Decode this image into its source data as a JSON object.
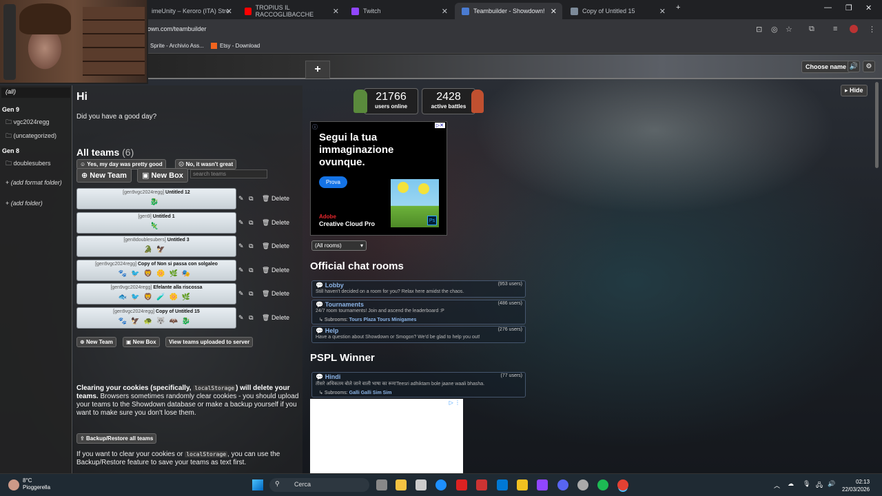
{
  "browser": {
    "tabs": [
      {
        "label": "imeUnity – Keroro (ITA) Stre",
        "color": "#3b5998"
      },
      {
        "label": "TROPIUS IL RACCOGLIBACCHE",
        "color": "#ff0000"
      },
      {
        "label": "Twitch",
        "color": "#9146ff"
      },
      {
        "label": "Teambuilder - Showdown!",
        "color": "#4a7bd1"
      },
      {
        "label": "Copy of Untitled 15",
        "color": "#7c8a99"
      }
    ],
    "url": "own.com/teambuilder",
    "bookmarks": [
      "Sprite - Archivio Ass...",
      "Etsy - Download"
    ]
  },
  "header": {
    "choose_name": "Choose name",
    "new_tab": "+"
  },
  "sidebar": {
    "all": "(all)",
    "gen9": "Gen 9",
    "gen9_folders": [
      "vgc2024regg",
      "(uncategorized)"
    ],
    "gen8": "Gen 8",
    "gen8_folders": [
      "doublesubers"
    ],
    "add_format_folder": "(add format folder)",
    "add_folder": "(add folder)"
  },
  "teams_panel": {
    "greeting": "Hi",
    "question": "Did you have a good day?",
    "yes": "Yes, my day was pretty good",
    "no": "No, it wasn't great",
    "all_teams": "All teams",
    "count": "(6)",
    "new_team": "New Team",
    "new_box": "New Box",
    "search_placeholder": "search teams",
    "teams": [
      {
        "format": "[gen9vgc2024regg]",
        "name": "Untitled 12",
        "mons": "🐉"
      },
      {
        "format": "[gen9]",
        "name": "Untitled 1",
        "mons": "🦎"
      },
      {
        "format": "[gen8doublesubers]",
        "name": "Untitled 3",
        "mons": "🐊🦅"
      },
      {
        "format": "[gen9vgc2024regg]",
        "name": "Copy of Non si passa con solgaleo",
        "mons": "🐾🐦🦁🌼🌿🎭"
      },
      {
        "format": "[gen9vgc2024regg]",
        "name": "Efelante alla riscossa",
        "mons": "🐟🐦🦁🧪🌼🌿"
      },
      {
        "format": "[gen9vgc2024regg]",
        "name": "Copy of Untitled 15",
        "mons": "🐾🦅🐢🐺🦇🐉"
      }
    ],
    "delete": "Delete",
    "view_uploaded": "View teams uploaded to server",
    "warn_bold1": "Clearing your cookies (specifically,",
    "warn_code": "localStorage",
    "warn_bold2": ") will delete your teams.",
    "warn_text": "Browsers sometimes randomly clear cookies - you should upload your teams to the Showdown database or make a backup yourself if you want to make sure you don't lose them.",
    "backup": "Backup/Restore all teams",
    "warn2_a": "If you want to clear your cookies or",
    "warn2_code": "localStorage",
    "warn2_b": ", you can use the Backup/Restore feature to save your teams as text first."
  },
  "stats": {
    "users_online": "21766",
    "users_label": "users online",
    "active_battles": "2428",
    "battles_label": "active battles"
  },
  "ad": {
    "title": "Segui la tua immaginazione ovunque.",
    "cta": "Prova",
    "brand": "Adobe",
    "product": "Creative Cloud Pro"
  },
  "rooms": {
    "filter": "(All rooms)",
    "official_title": "Official chat rooms",
    "official": [
      {
        "name": "Lobby",
        "users": "(953 users)",
        "desc": "Still haven't decided on a room for you? Relax here amidst the chaos.",
        "sub": ""
      },
      {
        "name": "Tournaments",
        "users": "(486 users)",
        "desc": "24/7 room tournaments! Join and ascend the leaderboard :P",
        "sub": "Tours Plaza  Tours Minigames"
      },
      {
        "name": "Help",
        "users": "(276 users)",
        "desc": "Have a question about Showdown or Smogon? We'd be glad to help you out!",
        "sub": ""
      }
    ],
    "pspl_title": "PSPL Winner",
    "pspl": [
      {
        "name": "Hindi",
        "users": "(77 users)",
        "desc": "तीसरे अधिकतम बोले जाने वाली भाषा का रूम!Teesri adhiktam bole jaane waali bhasha.",
        "sub": "Galli Galli Sim Sim"
      }
    ],
    "subrooms_label": "Subrooms:"
  },
  "hide": "Hide",
  "taskbar": {
    "temp": "8°C",
    "weather": "Pioggerella",
    "search": "Cerca",
    "time": "02:13",
    "date": "22/03/2026"
  }
}
